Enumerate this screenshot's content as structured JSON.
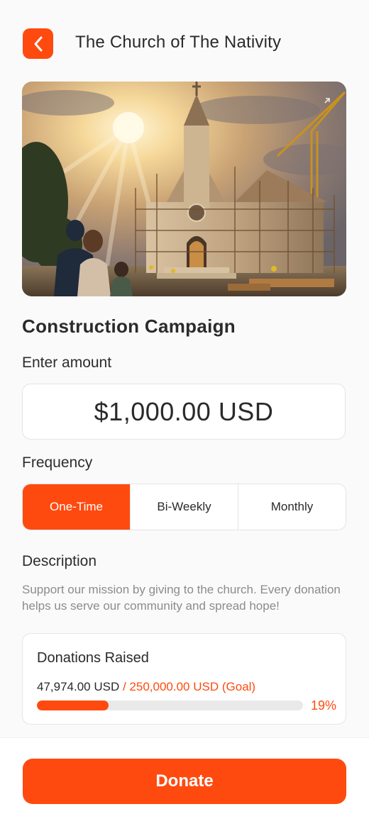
{
  "header": {
    "title": "The Church of The Nativity",
    "back_icon": "chevron-left-icon"
  },
  "hero": {
    "description_icon": "expand-icon"
  },
  "campaign": {
    "title": "Construction Campaign"
  },
  "amount": {
    "label": "Enter amount",
    "value": "$1,000.00 USD"
  },
  "frequency": {
    "label": "Frequency",
    "options": [
      "One-Time",
      "Bi-Weekly",
      "Monthly"
    ],
    "selected": "One-Time"
  },
  "description": {
    "label": "Description",
    "text": "Support our mission by giving to the church. Every donation helps us serve our community and spread hope!"
  },
  "donations": {
    "title": "Donations Raised",
    "raised": "47,974.00 USD",
    "goal": "/ 250,000.00 USD (Goal)",
    "percent_label": "19%",
    "progress": 0.19
  },
  "footer": {
    "donate_label": "Donate"
  },
  "colors": {
    "accent": "#ff4a0f",
    "background": "#fafafa"
  }
}
